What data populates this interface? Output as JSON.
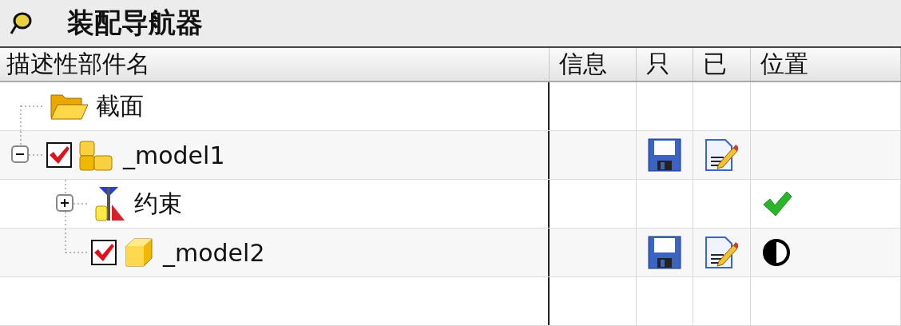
{
  "title": "装配导航器",
  "columns": [
    {
      "kind": "name",
      "label": "描述性部件名"
    },
    {
      "kind": "info",
      "label": "信息"
    },
    {
      "kind": "read_only",
      "label": "只"
    },
    {
      "kind": "modified",
      "label": "已"
    },
    {
      "kind": "position",
      "label": "位置"
    }
  ],
  "tree": [
    {
      "kind": "folder",
      "name": "截面",
      "read_only": false,
      "modified": false,
      "fully_positioned": false,
      "partially_positioned": false
    },
    {
      "kind": "assembly",
      "name": "_model1",
      "expanded": true,
      "checked": true,
      "read_only": true,
      "modified": true,
      "fully_positioned": false,
      "partially_positioned": false,
      "children": [
        {
          "kind": "constraints",
          "name": "约束",
          "expanded": false,
          "read_only": false,
          "modified": false,
          "fully_positioned": true,
          "partially_positioned": false
        },
        {
          "kind": "part",
          "name": "_model2",
          "checked": true,
          "read_only": true,
          "modified": true,
          "fully_positioned": false,
          "partially_positioned": true
        }
      ]
    }
  ]
}
